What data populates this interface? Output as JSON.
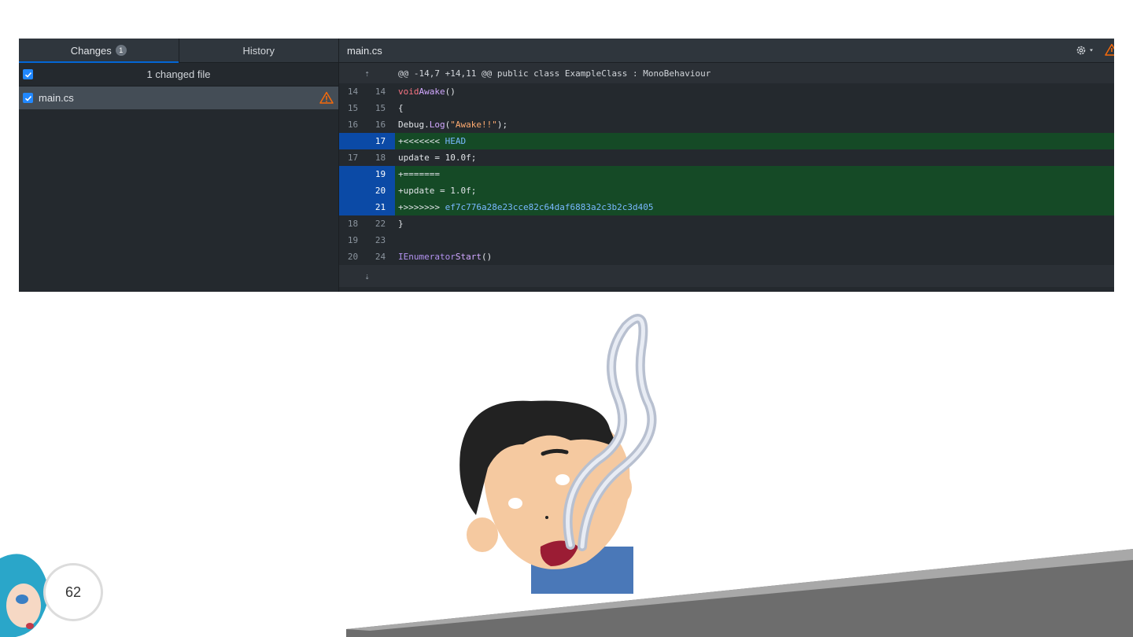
{
  "left": {
    "tabs": [
      {
        "label": "Changes",
        "badge": "1"
      },
      {
        "label": "History"
      }
    ],
    "changed_files_label": "1 changed file",
    "files": [
      {
        "name": "main.cs"
      }
    ]
  },
  "right": {
    "file_name": "main.cs",
    "hunk_header": "@@ -14,7 +14,11 @@ public class ExampleClass : MonoBehaviour",
    "lines": [
      {
        "old": "14",
        "new": "14",
        "type": "ctx"
      },
      {
        "old": "15",
        "new": "15",
        "type": "ctx"
      },
      {
        "old": "16",
        "new": "16",
        "type": "ctx"
      },
      {
        "old": "",
        "new": "17",
        "type": "add"
      },
      {
        "old": "17",
        "new": "18",
        "type": "ctx"
      },
      {
        "old": "",
        "new": "19",
        "type": "add"
      },
      {
        "old": "",
        "new": "20",
        "type": "add"
      },
      {
        "old": "",
        "new": "21",
        "type": "add"
      },
      {
        "old": "18",
        "new": "22",
        "type": "ctx"
      },
      {
        "old": "19",
        "new": "23",
        "type": "ctx"
      },
      {
        "old": "20",
        "new": "24",
        "type": "ctx"
      }
    ],
    "code": {
      "l1_kw": "void",
      "l1_fn": "Awake",
      "l1_rest": "()",
      "l2": "{",
      "l3_obj": "Debug.",
      "l3_fn": "Log",
      "l3_str": "\"Awake!!\"",
      "l3_end": ");",
      "l4_prefix": "+<<<<<<< ",
      "l4_ref": "HEAD",
      "l5": "update = 10.0f;",
      "l6": "+=======",
      "l7_prefix": "+",
      "l7": "update = 1.0f;",
      "l8_prefix": "+>>>>>>> ",
      "l8_sha": "ef7c776a28e23cce82c64daf6883a2c3b2c3d405",
      "l9": "}",
      "l10": "",
      "l11_type": "IEnumerator",
      "l11_fn": "Start",
      "l11_rest": "()"
    }
  },
  "page_number": "62",
  "colors": {
    "accent": "#0366d6",
    "warning": "#f66a0a",
    "added_bg": "#154a26",
    "added_gutter": "#0b4aa6"
  }
}
